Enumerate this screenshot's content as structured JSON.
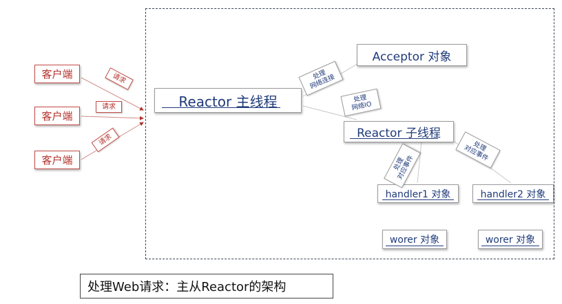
{
  "clients": [
    "客户端",
    "客户端",
    "客户端"
  ],
  "request_labels": [
    "请求",
    "请求",
    "请求"
  ],
  "main_reactor": "Reactor 主线程",
  "acceptor": "Acceptor 对象",
  "sub_reactor": "Reactor 子线程",
  "handler1": "handler1 对象",
  "handler2": "handler2 对象",
  "worker1": "worer 对象",
  "worker2": "worer 对象",
  "edge_labels": {
    "handle_connection": [
      "处理",
      "网络连接"
    ],
    "handle_io": [
      "处理",
      "网络IO"
    ],
    "handle_event_1": [
      "处理",
      "对应事件"
    ],
    "handle_event_2": [
      "处理",
      "对应事件"
    ]
  },
  "caption": "处理Web请求：主从Reactor的架构",
  "colors": {
    "client_red": "#b3312b",
    "node_blue": "#1f3a7a",
    "frame": "#3b4556"
  }
}
